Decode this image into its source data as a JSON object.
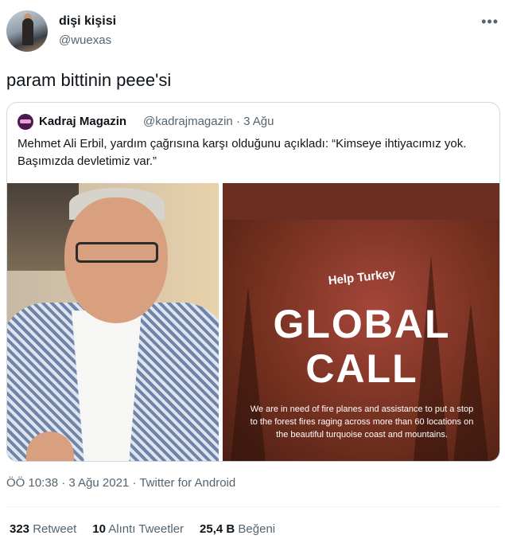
{
  "author": {
    "name": "dişi kişisi",
    "handle": "@wuexas"
  },
  "more_icon": "ellipsis-icon",
  "tweet": {
    "text": "param bittinin peee'si"
  },
  "quoted": {
    "name": "Kadraj Magazin",
    "handle_date": "@kadrajmagazin · 3 Ağu",
    "text": "Mehmet Ali Erbil, yardım çağrısına karşı olduğunu açıkladı: “Kimseye ihtiyacımız yok. Başımızda devletimiz var.”",
    "image_right": {
      "help": "Help Turkey",
      "title_line1": "GLOBAL",
      "title_line2": "CALL",
      "body": "We are in need of fire planes and assistance to put a stop to the forest fires raging across more than 60 locations on the beautiful turquoise coast and mountains."
    }
  },
  "meta": "ÖÖ 10:38 · 3 Ağu 2021 · Twitter for Android",
  "stats": {
    "retweets_num": "323",
    "retweets_label": "Retweet",
    "quotes_num": "10",
    "quotes_label": "Alıntı Tweetler",
    "likes_num": "25,4 B",
    "likes_label": "Beğeni"
  },
  "colors": {
    "text": "#0f1419",
    "secondary": "#536471",
    "border": "#cfd9de"
  }
}
